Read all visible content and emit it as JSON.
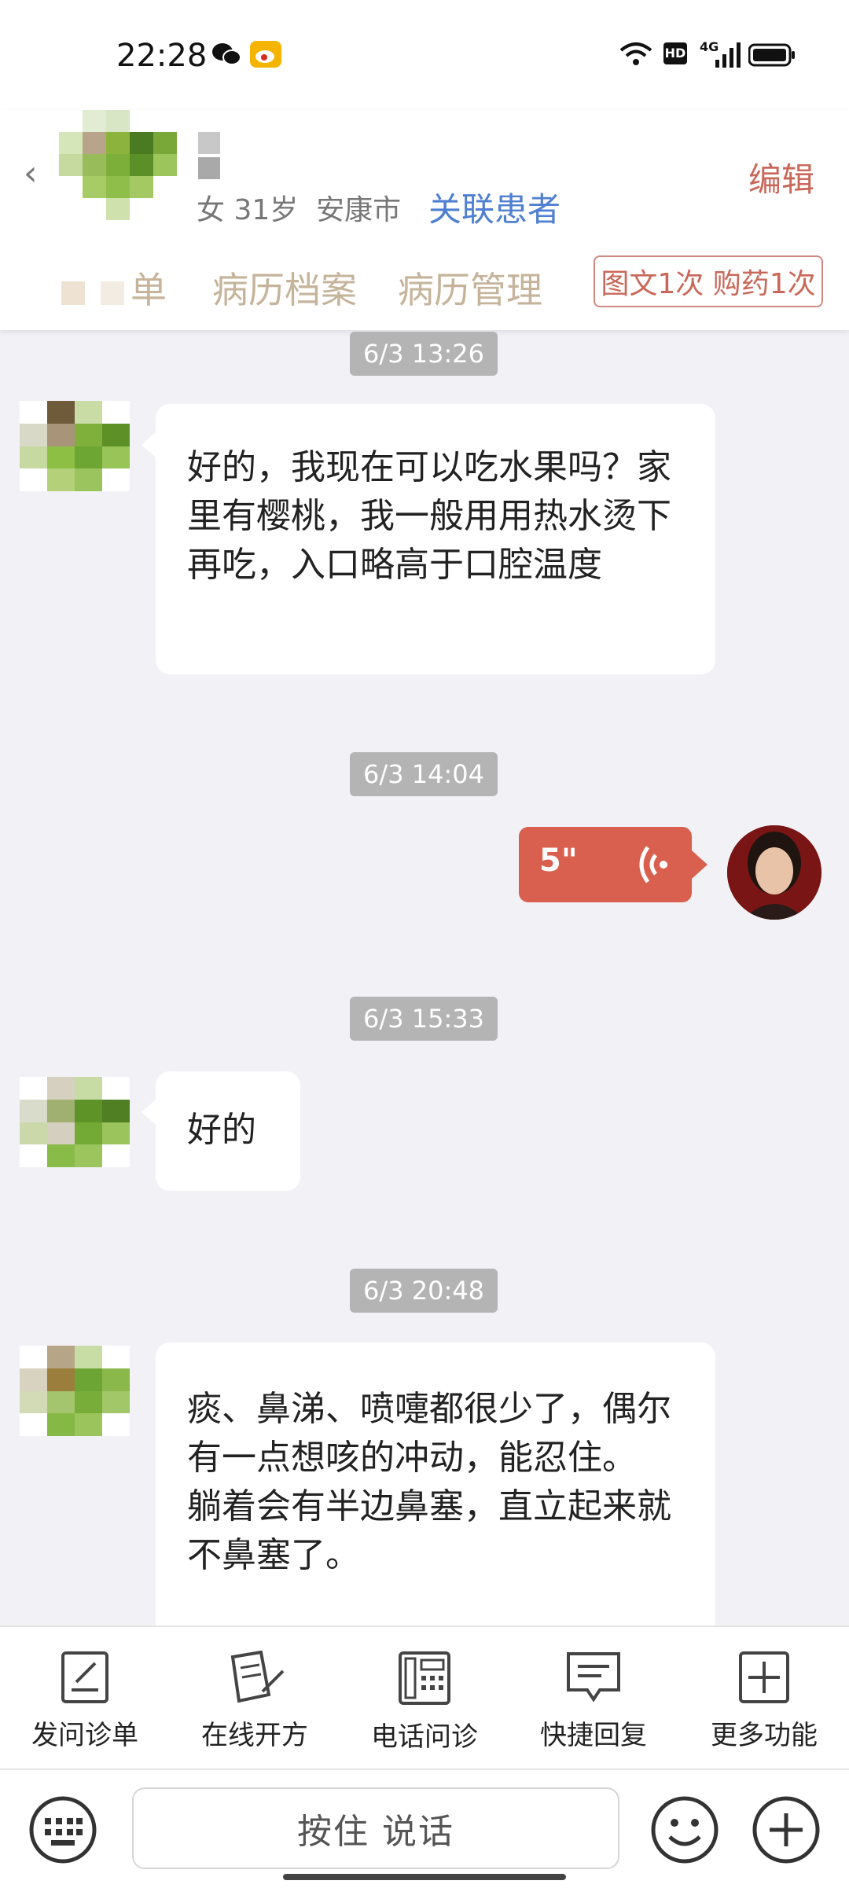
{
  "status_bar": {
    "time": "22:28",
    "hd_label": "HD",
    "network_label": "4G"
  },
  "header": {
    "patient_info": "女 31岁  安康市",
    "link_patient": "关联患者",
    "edit": "编辑",
    "tabs": [
      "单",
      "病历档案",
      "病历管理"
    ],
    "counter_badge": "图文1次 购药1次"
  },
  "messages": [
    {
      "time": "6/3 13:26",
      "sender": "patient",
      "text": "好的，我现在可以吃水果吗？家里有樱桃，我一般用用热水烫下再吃，入口略高于口腔温度"
    },
    {
      "time": "6/3 14:04",
      "sender": "doctor",
      "type": "voice",
      "duration": "5\""
    },
    {
      "time": "6/3 15:33",
      "sender": "patient",
      "text": "好的"
    },
    {
      "time": "6/3 20:48",
      "sender": "patient",
      "text": "痰、鼻涕、喷嚏都很少了，偶尔有一点想咳的冲动，能忍住。\n躺着会有半边鼻塞，直立起来就不鼻塞了。"
    }
  ],
  "toolbar": [
    {
      "label": "发问诊单",
      "icon": "form-edit-icon"
    },
    {
      "label": "在线开方",
      "icon": "prescription-icon"
    },
    {
      "label": "电话问诊",
      "icon": "phone-icon"
    },
    {
      "label": "快捷回复",
      "icon": "message-icon"
    },
    {
      "label": "更多功能",
      "icon": "plus-box-icon"
    }
  ],
  "input": {
    "talk_button": "按住 说话"
  },
  "colors": {
    "accent": "#d9604f",
    "link": "#4f7fd0",
    "tab": "#c5b49a"
  }
}
